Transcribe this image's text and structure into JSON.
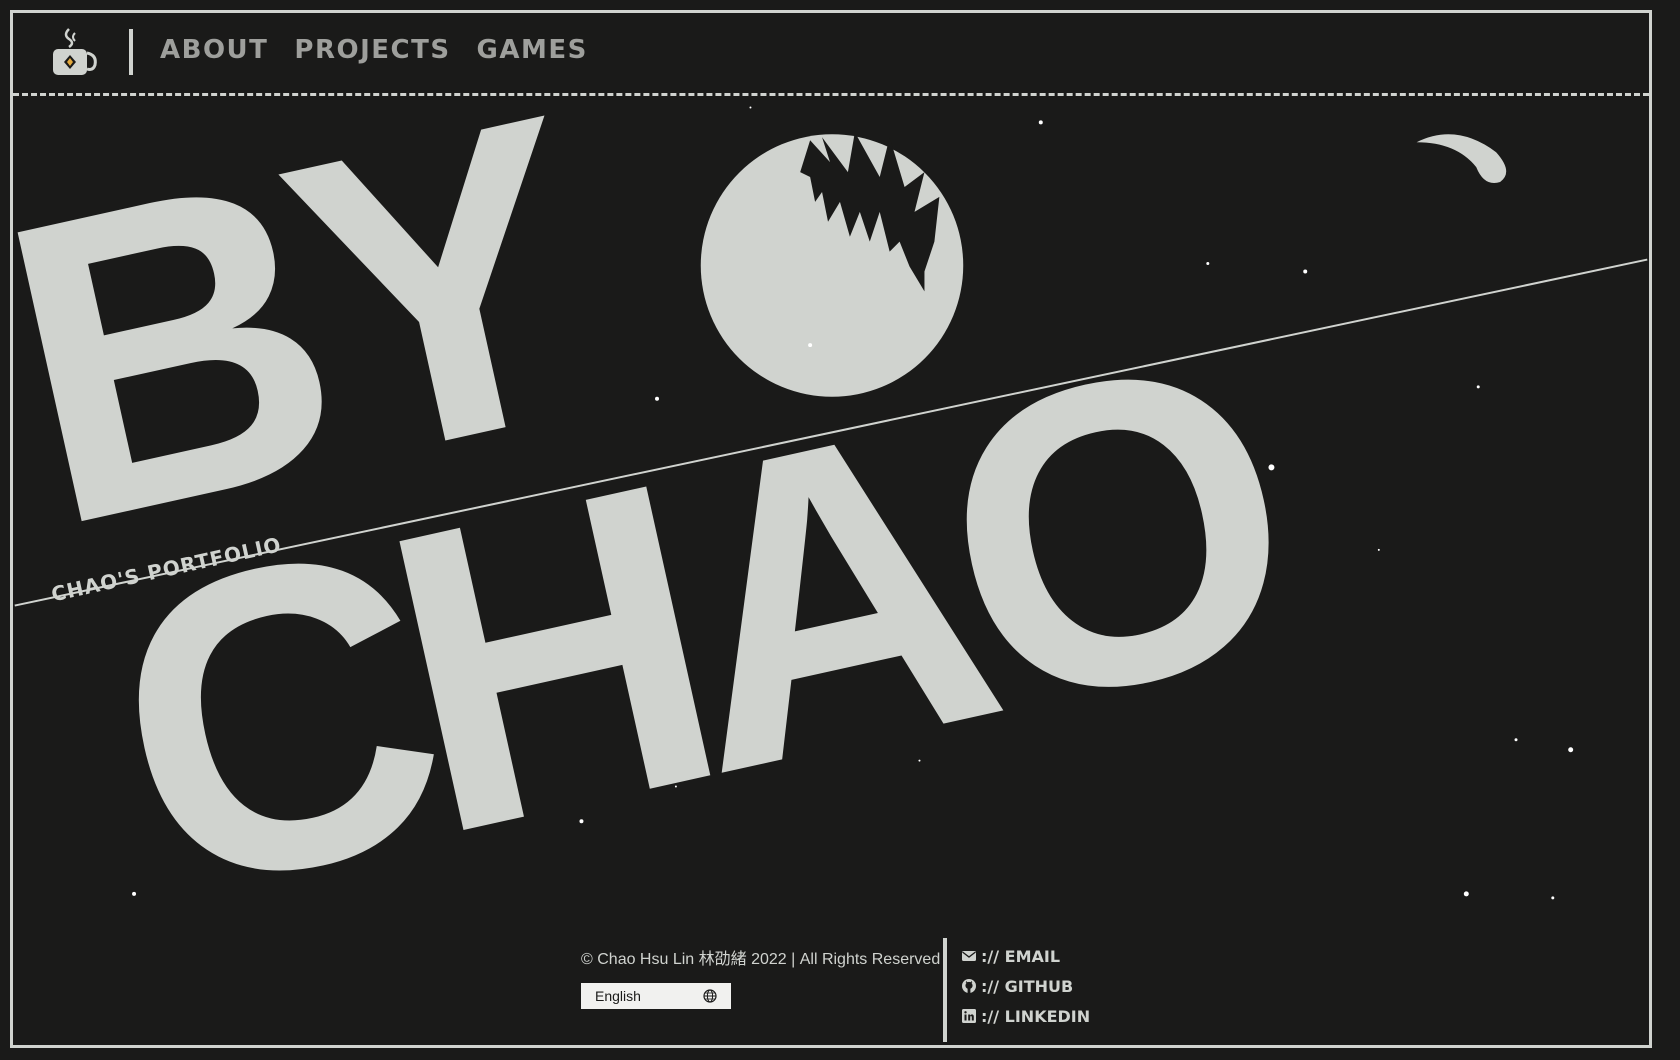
{
  "header": {
    "logo_icon": "coffee-cup-icon",
    "nav": [
      {
        "label": "ABOUT"
      },
      {
        "label": "PROJECTS"
      },
      {
        "label": "GAMES"
      }
    ]
  },
  "hero": {
    "line1": "BY",
    "line2": "CHAO",
    "subtitle": "CHAO'S PORTFOLIO"
  },
  "footer": {
    "copyright": "© Chao Hsu Lin 林劭緒 2022 | All Rights Reserved",
    "language": {
      "selected": "English",
      "icon": "globe-icon"
    },
    "links": [
      {
        "icon": "envelope-icon",
        "label": ":// EMAIL"
      },
      {
        "icon": "github-icon",
        "label": ":// GITHUB"
      },
      {
        "icon": "linkedin-icon",
        "label": ":// LINKEDIN"
      }
    ]
  },
  "colors": {
    "background": "#1a1a19",
    "foreground": "#d0d3cf",
    "nav_text": "#9e9f9c",
    "language_bg": "#f1f1ef"
  }
}
